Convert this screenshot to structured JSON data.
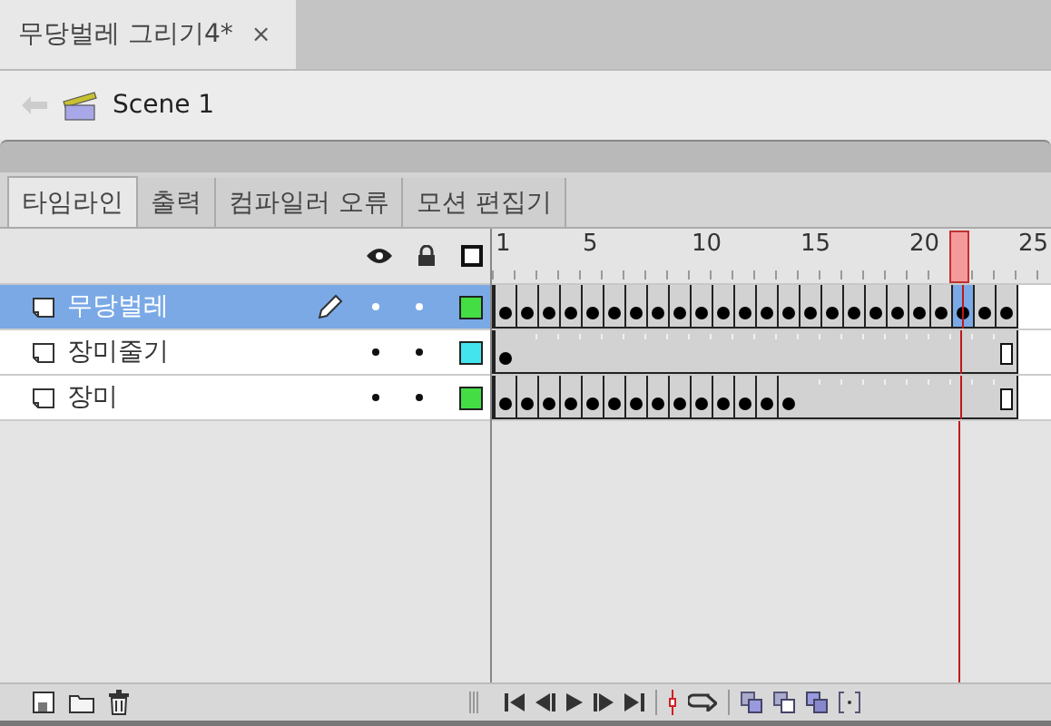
{
  "document_tab": {
    "title": "무당벌레 그리기4*",
    "close": "×"
  },
  "breadcrumb": {
    "scene": "Scene 1"
  },
  "panel_tabs": [
    {
      "label": "타임라인",
      "selected": true
    },
    {
      "label": "출력",
      "selected": false
    },
    {
      "label": "컴파일러 오류",
      "selected": false
    },
    {
      "label": "모션 편집기",
      "selected": false
    }
  ],
  "ruler": {
    "labels": [
      "1",
      "5",
      "10",
      "15",
      "20",
      "25"
    ]
  },
  "layers": [
    {
      "name": "무당벌레",
      "selected": true,
      "editing": true,
      "color": "#44dd44",
      "frames": [
        {
          "kind": "key",
          "selected": false
        },
        {
          "kind": "key",
          "selected": false
        },
        {
          "kind": "key",
          "selected": false
        },
        {
          "kind": "key",
          "selected": false
        },
        {
          "kind": "key",
          "selected": false
        },
        {
          "kind": "key",
          "selected": false
        },
        {
          "kind": "key",
          "selected": false
        },
        {
          "kind": "key",
          "selected": false
        },
        {
          "kind": "key",
          "selected": false
        },
        {
          "kind": "key",
          "selected": false
        },
        {
          "kind": "key",
          "selected": false
        },
        {
          "kind": "key",
          "selected": false
        },
        {
          "kind": "key",
          "selected": false
        },
        {
          "kind": "key",
          "selected": false
        },
        {
          "kind": "key",
          "selected": false
        },
        {
          "kind": "key",
          "selected": false
        },
        {
          "kind": "key",
          "selected": false
        },
        {
          "kind": "key",
          "selected": false
        },
        {
          "kind": "key",
          "selected": false
        },
        {
          "kind": "key",
          "selected": false
        },
        {
          "kind": "key",
          "selected": false
        },
        {
          "kind": "key",
          "selected": true
        },
        {
          "kind": "key",
          "selected": false
        },
        {
          "kind": "key",
          "selected": false
        }
      ]
    },
    {
      "name": "장미줄기",
      "selected": false,
      "editing": false,
      "color": "#44e4ee",
      "frames": [
        {
          "kind": "key",
          "selected": false
        },
        {
          "kind": "hold",
          "selected": false
        },
        {
          "kind": "hold",
          "selected": false
        },
        {
          "kind": "hold",
          "selected": false
        },
        {
          "kind": "hold",
          "selected": false
        },
        {
          "kind": "hold",
          "selected": false
        },
        {
          "kind": "hold",
          "selected": false
        },
        {
          "kind": "hold",
          "selected": false
        },
        {
          "kind": "hold",
          "selected": false
        },
        {
          "kind": "hold",
          "selected": false
        },
        {
          "kind": "hold",
          "selected": false
        },
        {
          "kind": "hold",
          "selected": false
        },
        {
          "kind": "hold",
          "selected": false
        },
        {
          "kind": "hold",
          "selected": false
        },
        {
          "kind": "hold",
          "selected": false
        },
        {
          "kind": "hold",
          "selected": false
        },
        {
          "kind": "hold",
          "selected": false
        },
        {
          "kind": "hold",
          "selected": false
        },
        {
          "kind": "hold",
          "selected": false
        },
        {
          "kind": "hold",
          "selected": false
        },
        {
          "kind": "hold",
          "selected": false
        },
        {
          "kind": "hold",
          "selected": false
        },
        {
          "kind": "hold",
          "selected": false
        },
        {
          "kind": "end",
          "selected": false
        }
      ]
    },
    {
      "name": "장미",
      "selected": false,
      "editing": false,
      "color": "#44dd44",
      "frames": [
        {
          "kind": "key",
          "selected": false
        },
        {
          "kind": "key",
          "selected": false
        },
        {
          "kind": "key",
          "selected": false
        },
        {
          "kind": "key",
          "selected": false
        },
        {
          "kind": "key",
          "selected": false
        },
        {
          "kind": "key",
          "selected": false
        },
        {
          "kind": "key",
          "selected": false
        },
        {
          "kind": "key",
          "selected": false
        },
        {
          "kind": "key",
          "selected": false
        },
        {
          "kind": "key",
          "selected": false
        },
        {
          "kind": "key",
          "selected": false
        },
        {
          "kind": "key",
          "selected": false
        },
        {
          "kind": "key",
          "selected": false
        },
        {
          "kind": "key",
          "selected": false
        },
        {
          "kind": "hold",
          "selected": false
        },
        {
          "kind": "hold",
          "selected": false
        },
        {
          "kind": "hold",
          "selected": false
        },
        {
          "kind": "hold",
          "selected": false
        },
        {
          "kind": "hold",
          "selected": false
        },
        {
          "kind": "hold",
          "selected": false
        },
        {
          "kind": "hold",
          "selected": false
        },
        {
          "kind": "hold",
          "selected": false
        },
        {
          "kind": "hold",
          "selected": false
        },
        {
          "kind": "end",
          "selected": false
        }
      ]
    }
  ]
}
